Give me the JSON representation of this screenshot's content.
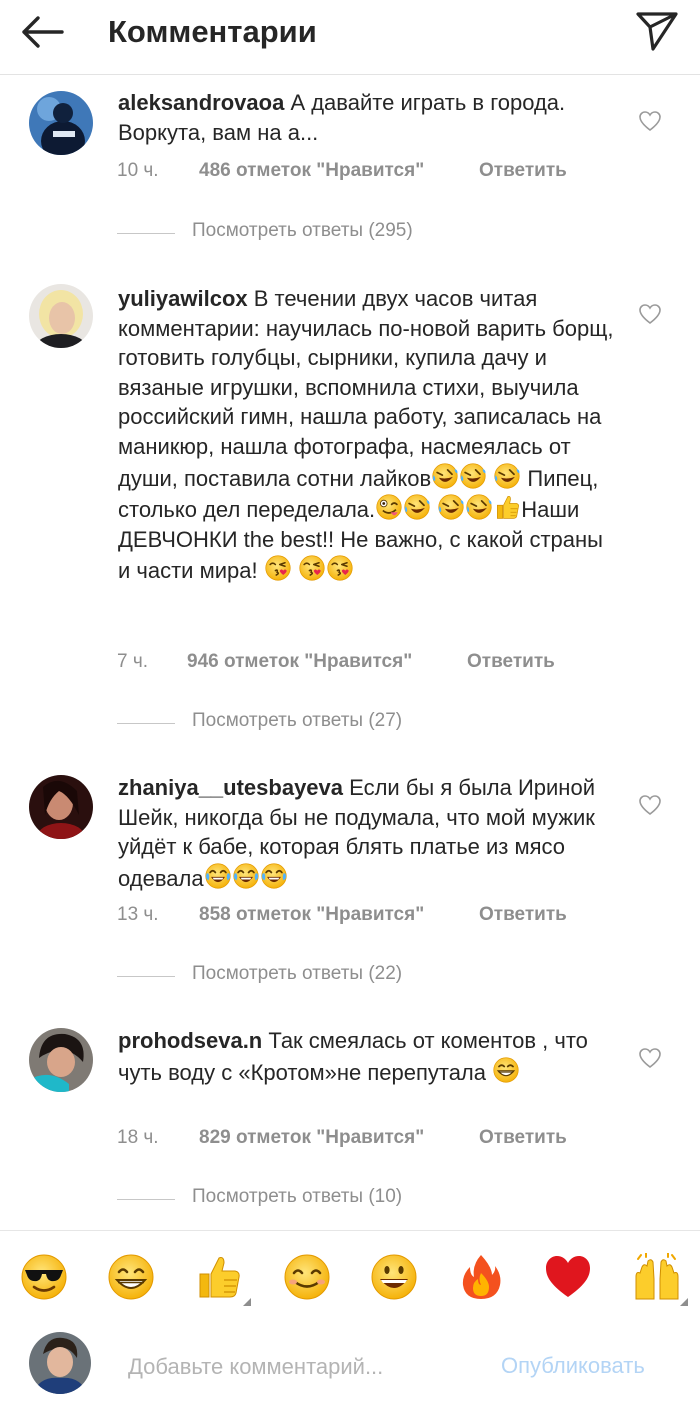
{
  "header": {
    "title": "Комментарии",
    "back_icon": "arrow-left-icon",
    "send_icon": "paper-plane-icon"
  },
  "comments": [
    {
      "username": "aleksandrovaoa",
      "text": "А давайте играть в города. Воркута, вам на а...",
      "time": "10 ч.",
      "likes": "486 отметок \"Нравится\"",
      "reply": "Ответить",
      "view_replies": "Посмотреть ответы (295)"
    },
    {
      "username": "yuliyawilcox",
      "text1": "В течении двух часов читая комментарии: научилась по-новой варить борщ, готовить голубцы, сырники, купила дачу и вязаные игрушки, вспомнила стихи, выучила российский гимн, нашла работу, записалась на маникюр, нашла фотографа, насмеялась от души, поставила сотни лайков",
      "text2": " Пипец, столько дел переделала.",
      "text3": "Наши ДЕВЧОНКИ  the best!! Не важно, с какой страны и части мира! ",
      "time": "7 ч.",
      "likes": "946 отметок \"Нравится\"",
      "reply": "Ответить",
      "view_replies": "Посмотреть ответы (27)"
    },
    {
      "username": "zhaniya__utesbayeva",
      "text": "Если бы я была Ириной Шейк, никогда бы не подумала, что мой мужик уйдёт к бабе, которая блять платье из мясо одевала",
      "time": "13 ч.",
      "likes": "858 отметок \"Нравится\"",
      "reply": "Ответить",
      "view_replies": "Посмотреть ответы (22)"
    },
    {
      "username": "prohodseva.n",
      "text": "Так смеялась от коментов , что чуть воду с «Кротом»не перепутала",
      "time": "18 ч.",
      "likes": "829 отметок \"Нравится\"",
      "reply": "Ответить",
      "view_replies": "Посмотреть ответы (10)"
    }
  ],
  "emoji_bar": [
    "sunglasses-emoji",
    "grin-emoji",
    "thumbs-up-emoji",
    "smile-emoji",
    "grinning-emoji",
    "fire-emoji",
    "heart-emoji",
    "raised-hands-emoji"
  ],
  "compose": {
    "placeholder": "Добавьте комментарий...",
    "publish": "Опубликовать"
  },
  "colors": {
    "text": "#262626",
    "secondary": "#8e8e8e",
    "link_disabled": "#b3d4f5"
  }
}
